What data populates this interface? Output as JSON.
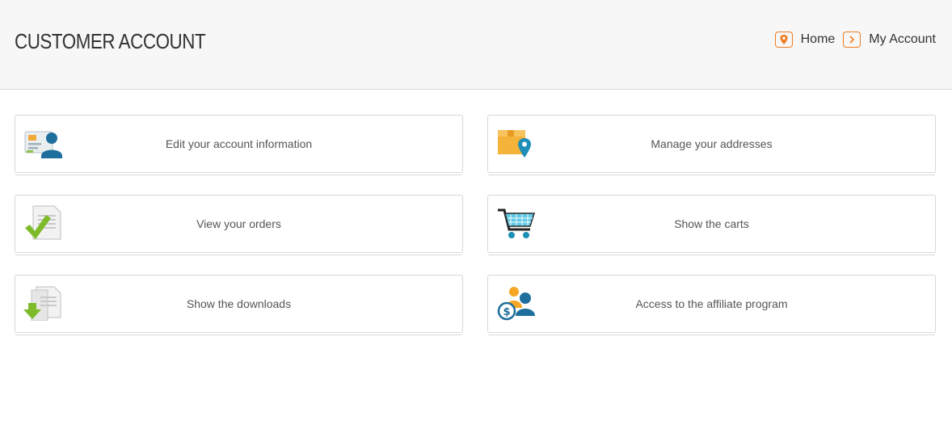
{
  "header": {
    "title": "CUSTOMER ACCOUNT",
    "breadcrumb": [
      {
        "label": "Home",
        "icon": "map-pin-icon"
      },
      {
        "label": "My Account",
        "icon": "chevron-right-icon"
      }
    ],
    "accent_color": "#f07c1f"
  },
  "tiles": [
    {
      "label": "Edit your account information",
      "icon": "user-card-icon"
    },
    {
      "label": "Manage your addresses",
      "icon": "address-box-pin-icon"
    },
    {
      "label": "View your orders",
      "icon": "document-check-icon"
    },
    {
      "label": "Show the carts",
      "icon": "shopping-cart-icon"
    },
    {
      "label": "Show the downloads",
      "icon": "document-download-icon"
    },
    {
      "label": "Access to the affiliate program",
      "icon": "affiliate-users-dollar-icon"
    }
  ]
}
